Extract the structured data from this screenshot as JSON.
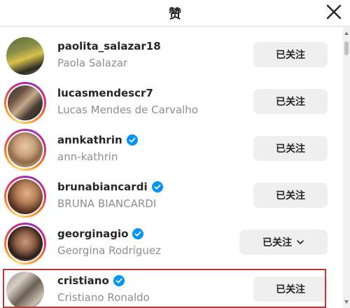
{
  "dialog": {
    "title": "赞",
    "close_icon": "close-icon"
  },
  "colors": {
    "verified": "#0095f6",
    "button_bg": "#efefef",
    "secondary_text": "#8e8e8e",
    "highlight_border": "#b5393b"
  },
  "likers": [
    {
      "username": "paolita_salazar18",
      "full_name": "Paola Salazar",
      "verified": false,
      "button_label": "已关注",
      "has_dropdown": false
    },
    {
      "username": "lucasmendescr7",
      "full_name": "Lucas Mendes de Carvalho",
      "verified": false,
      "button_label": "已关注",
      "has_dropdown": false
    },
    {
      "username": "annkathrin",
      "full_name": "ann-kathrin",
      "verified": true,
      "button_label": "已关注",
      "has_dropdown": false
    },
    {
      "username": "brunabiancardi",
      "full_name": "BRUNA BIANCARDI",
      "verified": true,
      "button_label": "已关注",
      "has_dropdown": false
    },
    {
      "username": "georginagio",
      "full_name": "Georgina Rodríguez",
      "verified": true,
      "button_label": "已关注",
      "has_dropdown": true
    },
    {
      "username": "cristiano",
      "full_name": "Cristiano Ronaldo",
      "verified": true,
      "button_label": "已关注",
      "has_dropdown": false
    }
  ]
}
